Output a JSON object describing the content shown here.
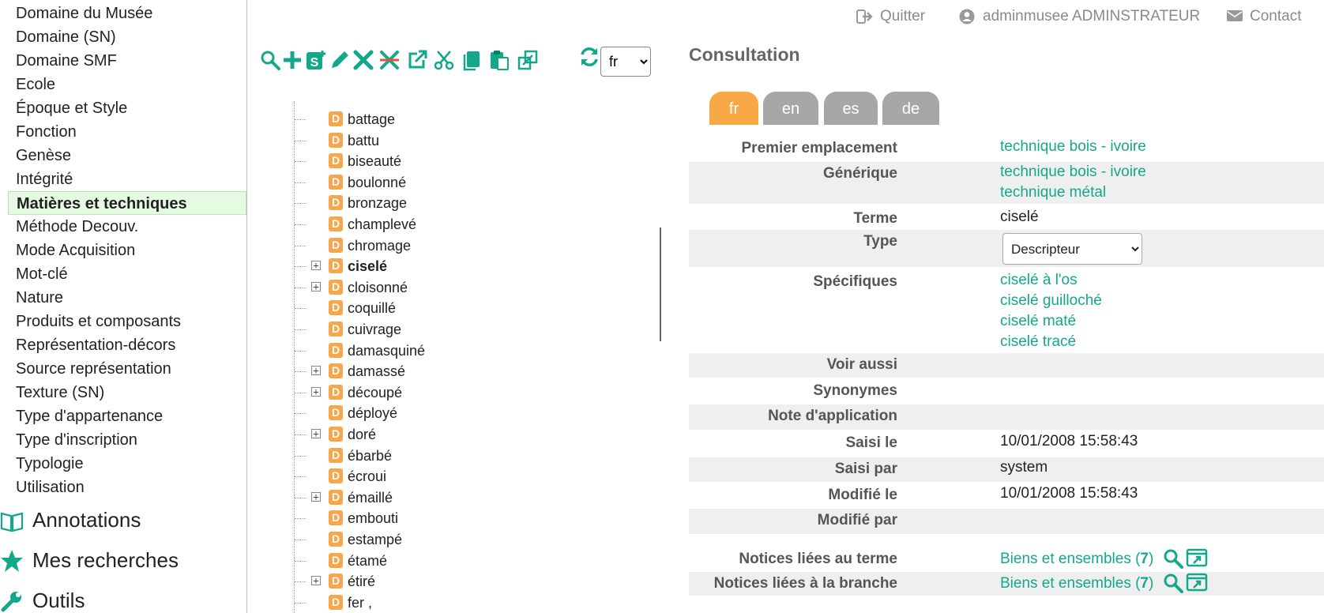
{
  "header": {
    "quit_label": "Quitter",
    "user_label": "adminmusee ADMINSTRATEUR",
    "contact_label": "Contact"
  },
  "sidebar": {
    "items": [
      {
        "label": "Domaine du Musée"
      },
      {
        "label": "Domaine (SN)"
      },
      {
        "label": "Domaine SMF"
      },
      {
        "label": "Ecole"
      },
      {
        "label": "Époque et Style"
      },
      {
        "label": "Fonction"
      },
      {
        "label": "Genèse"
      },
      {
        "label": "Intégrité"
      },
      {
        "label": "Matières et techniques",
        "active": true
      },
      {
        "label": "Méthode Decouv."
      },
      {
        "label": "Mode Acquisition"
      },
      {
        "label": "Mot-clé"
      },
      {
        "label": "Nature"
      },
      {
        "label": "Produits et composants"
      },
      {
        "label": "Représentation-décors"
      },
      {
        "label": "Source représentation"
      },
      {
        "label": "Texture (SN)"
      },
      {
        "label": "Type d'appartenance"
      },
      {
        "label": "Type d'inscription"
      },
      {
        "label": "Typologie"
      },
      {
        "label": "Utilisation"
      }
    ],
    "sections": [
      {
        "label": "Annotations",
        "icon": "book-icon"
      },
      {
        "label": "Mes recherches",
        "icon": "star-icon"
      },
      {
        "label": "Outils",
        "icon": "wrench-icon"
      }
    ]
  },
  "toolbar": {
    "icons": [
      "search-icon",
      "add-icon",
      "add-specific-icon",
      "edit-icon",
      "delete-icon",
      "delete-branch-icon",
      "open-external-icon",
      "cut-icon",
      "copy-icon",
      "paste-icon",
      "link-icon"
    ],
    "refresh_icon": "refresh-icon",
    "language_value": "fr",
    "accent_color": "#14a88a"
  },
  "tree": {
    "badge_letter": "D",
    "badge_color": "#f6a64d",
    "expander_glyph": "+",
    "nodes": [
      {
        "label": "battage",
        "expandable": false
      },
      {
        "label": "battu",
        "expandable": false
      },
      {
        "label": "biseauté",
        "expandable": false
      },
      {
        "label": "boulonné",
        "expandable": false
      },
      {
        "label": "bronzage",
        "expandable": false
      },
      {
        "label": "champlevé",
        "expandable": false
      },
      {
        "label": "chromage",
        "expandable": false
      },
      {
        "label": "ciselé",
        "expandable": true,
        "selected": true
      },
      {
        "label": "cloisonné",
        "expandable": true
      },
      {
        "label": "coquillé",
        "expandable": false
      },
      {
        "label": "cuivrage",
        "expandable": false
      },
      {
        "label": "damasquiné",
        "expandable": false
      },
      {
        "label": "damassé",
        "expandable": true
      },
      {
        "label": "découpé",
        "expandable": true
      },
      {
        "label": "déployé",
        "expandable": false
      },
      {
        "label": "doré",
        "expandable": true
      },
      {
        "label": "ébarbé",
        "expandable": false
      },
      {
        "label": "écroui",
        "expandable": false
      },
      {
        "label": "émaillé",
        "expandable": true
      },
      {
        "label": "embouti",
        "expandable": false
      },
      {
        "label": "estampé",
        "expandable": false
      },
      {
        "label": "étamé",
        "expandable": false
      },
      {
        "label": "étiré",
        "expandable": true
      },
      {
        "label": "fer ,",
        "expandable": false
      }
    ]
  },
  "panel": {
    "title": "Consultation",
    "lang_tabs": [
      {
        "label": "fr",
        "active": true
      },
      {
        "label": "en"
      },
      {
        "label": "es"
      },
      {
        "label": "de"
      }
    ],
    "fields": {
      "premier_emplacement": {
        "label": "Premier emplacement",
        "value": "technique bois - ivoire"
      },
      "generique": {
        "label": "Générique",
        "values": [
          "technique bois - ivoire",
          "technique métal"
        ]
      },
      "terme": {
        "label": "Terme",
        "value": "ciselé"
      },
      "type": {
        "label": "Type",
        "value": "Descripteur"
      },
      "specifiques": {
        "label": "Spécifiques",
        "values": [
          "ciselé à l'os",
          "ciselé guilloché",
          "ciselé maté",
          "ciselé tracé"
        ]
      },
      "voir_aussi": {
        "label": "Voir aussi"
      },
      "synonymes": {
        "label": "Synonymes"
      },
      "note_application": {
        "label": "Note d'application"
      },
      "saisi_le": {
        "label": "Saisi le",
        "value": "10/01/2008 15:58:43"
      },
      "saisi_par": {
        "label": "Saisi par",
        "value": "system"
      },
      "modifie_le": {
        "label": "Modifié le",
        "value": "10/01/2008 15:58:43"
      },
      "modifie_par": {
        "label": "Modifié par"
      },
      "notices_terme": {
        "label": "Notices liées au terme",
        "link_text": "Biens et ensembles (",
        "count": "7",
        "close": ")"
      },
      "notices_branche": {
        "label": "Notices liées à la branche",
        "link_text": "Biens et ensembles (",
        "count": "7",
        "close": ")"
      }
    }
  }
}
